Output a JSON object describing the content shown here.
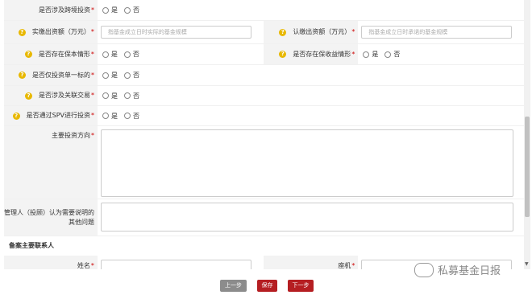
{
  "rows": {
    "r1": {
      "label": "是否涉及跨境投资",
      "yes": "是",
      "no": "否"
    },
    "r2": {
      "label": "实缴出资额（万元）",
      "placeholder": "指基金成立日时实际的基金规模",
      "label2": "认缴出资额（万元）",
      "placeholder2": "指基金成立日时承诺的基金规模"
    },
    "r3": {
      "label": "是否存在保本情形",
      "label2": "是否存在保收益情形",
      "yes": "是",
      "no": "否"
    },
    "r4": {
      "label": "是否仅投资单一标的",
      "yes": "是",
      "no": "否"
    },
    "r5": {
      "label": "是否涉及关联交易",
      "yes": "是",
      "no": "否"
    },
    "r6": {
      "label": "是否通过SPV进行投资",
      "yes": "是",
      "no": "否"
    },
    "r7": {
      "label": "主要投资方向"
    },
    "r8": {
      "label_line1": "管理人（投顾）认为需要说明的",
      "label_line2": "其他问题"
    }
  },
  "section": {
    "title": "备案主要联系人"
  },
  "contact": {
    "name_label": "姓名",
    "phone_label": "座机"
  },
  "required_mark": "*",
  "help_icon": "?",
  "buttons": {
    "prev": "上一步",
    "save": "保存",
    "next": "下一步"
  },
  "watermark": {
    "text": "私募基金日报"
  },
  "colors": {
    "required": "#cc0000",
    "save": "#b51e22",
    "prev": "#8c8c8c",
    "help": "#e8b800"
  }
}
